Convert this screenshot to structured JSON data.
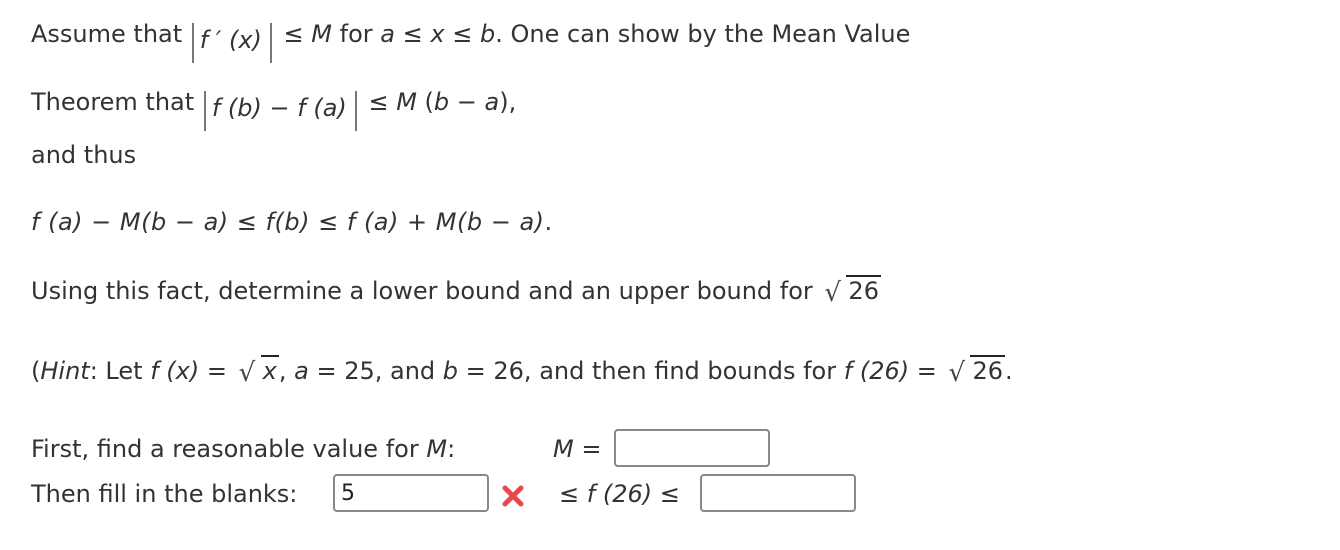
{
  "problem": {
    "line1": {
      "prefix": "Assume that",
      "abs_expr": "f ′ (x)",
      "mid": "≤ M for a ≤ x ≤ b. One can show by the Mean Value"
    },
    "line1_parts": {
      "le1": "≤",
      "M": "M",
      "for": "for",
      "a": "a",
      "le2": "≤",
      "x": "x",
      "le3": "≤",
      "b": "b",
      "rest": ". One can show by the Mean Value"
    },
    "line2": {
      "prefix": "Theorem that",
      "abs_f": "f",
      "abs_b": "(b)",
      "abs_minus": "−",
      "abs_f2": "f",
      "abs_a": "(a)",
      "le": "≤",
      "M": "M",
      "rhs_open": "(",
      "rhs_b": "b",
      "rhs_minus": "−",
      "rhs_a": "a",
      "rhs_close": "),"
    },
    "line3": "and thus",
    "inequality": {
      "part1": "f (a)",
      "minus1": "−",
      "part2": "M(b − a)",
      "le1": "≤",
      "part3": "f(b)",
      "le2": "≤",
      "part4": "f (a)",
      "plus": "+",
      "part5": "M(b − a)",
      "end": "."
    },
    "task": {
      "text": "Using this fact, determine a lower bound and an upper bound for",
      "radicand": "26"
    },
    "hint": {
      "open": "(",
      "hint_word": "Hint",
      "after_hint": ": Let",
      "f_of_x": "f (x)",
      "eq1": "=",
      "sqrt_x": "x",
      "comma_a": ",",
      "a": "a",
      "a_eq": "= 25, and",
      "b": "b",
      "b_eq": "= 26, and then find bounds for",
      "f26": "f (26)",
      "eq2": "=",
      "sqrt_26": "26",
      "end": "."
    }
  },
  "form": {
    "m_prompt_text": "First, find a reasonable value for",
    "m_prompt_var": "M",
    "m_prompt_colon": ":",
    "m_label_var": "M",
    "m_label_eq": "=",
    "m_input_value": "",
    "fill_prompt": "Then fill in the blanks:",
    "lower_input_value": "5",
    "lower_status": "incorrect",
    "middle_text_le1": "≤",
    "middle_text_f": "f (26)",
    "middle_text_le2": "≤",
    "upper_input_value": ""
  },
  "colors": {
    "text": "#333333",
    "error_x": "#e8474c",
    "input_border": "#888888"
  }
}
